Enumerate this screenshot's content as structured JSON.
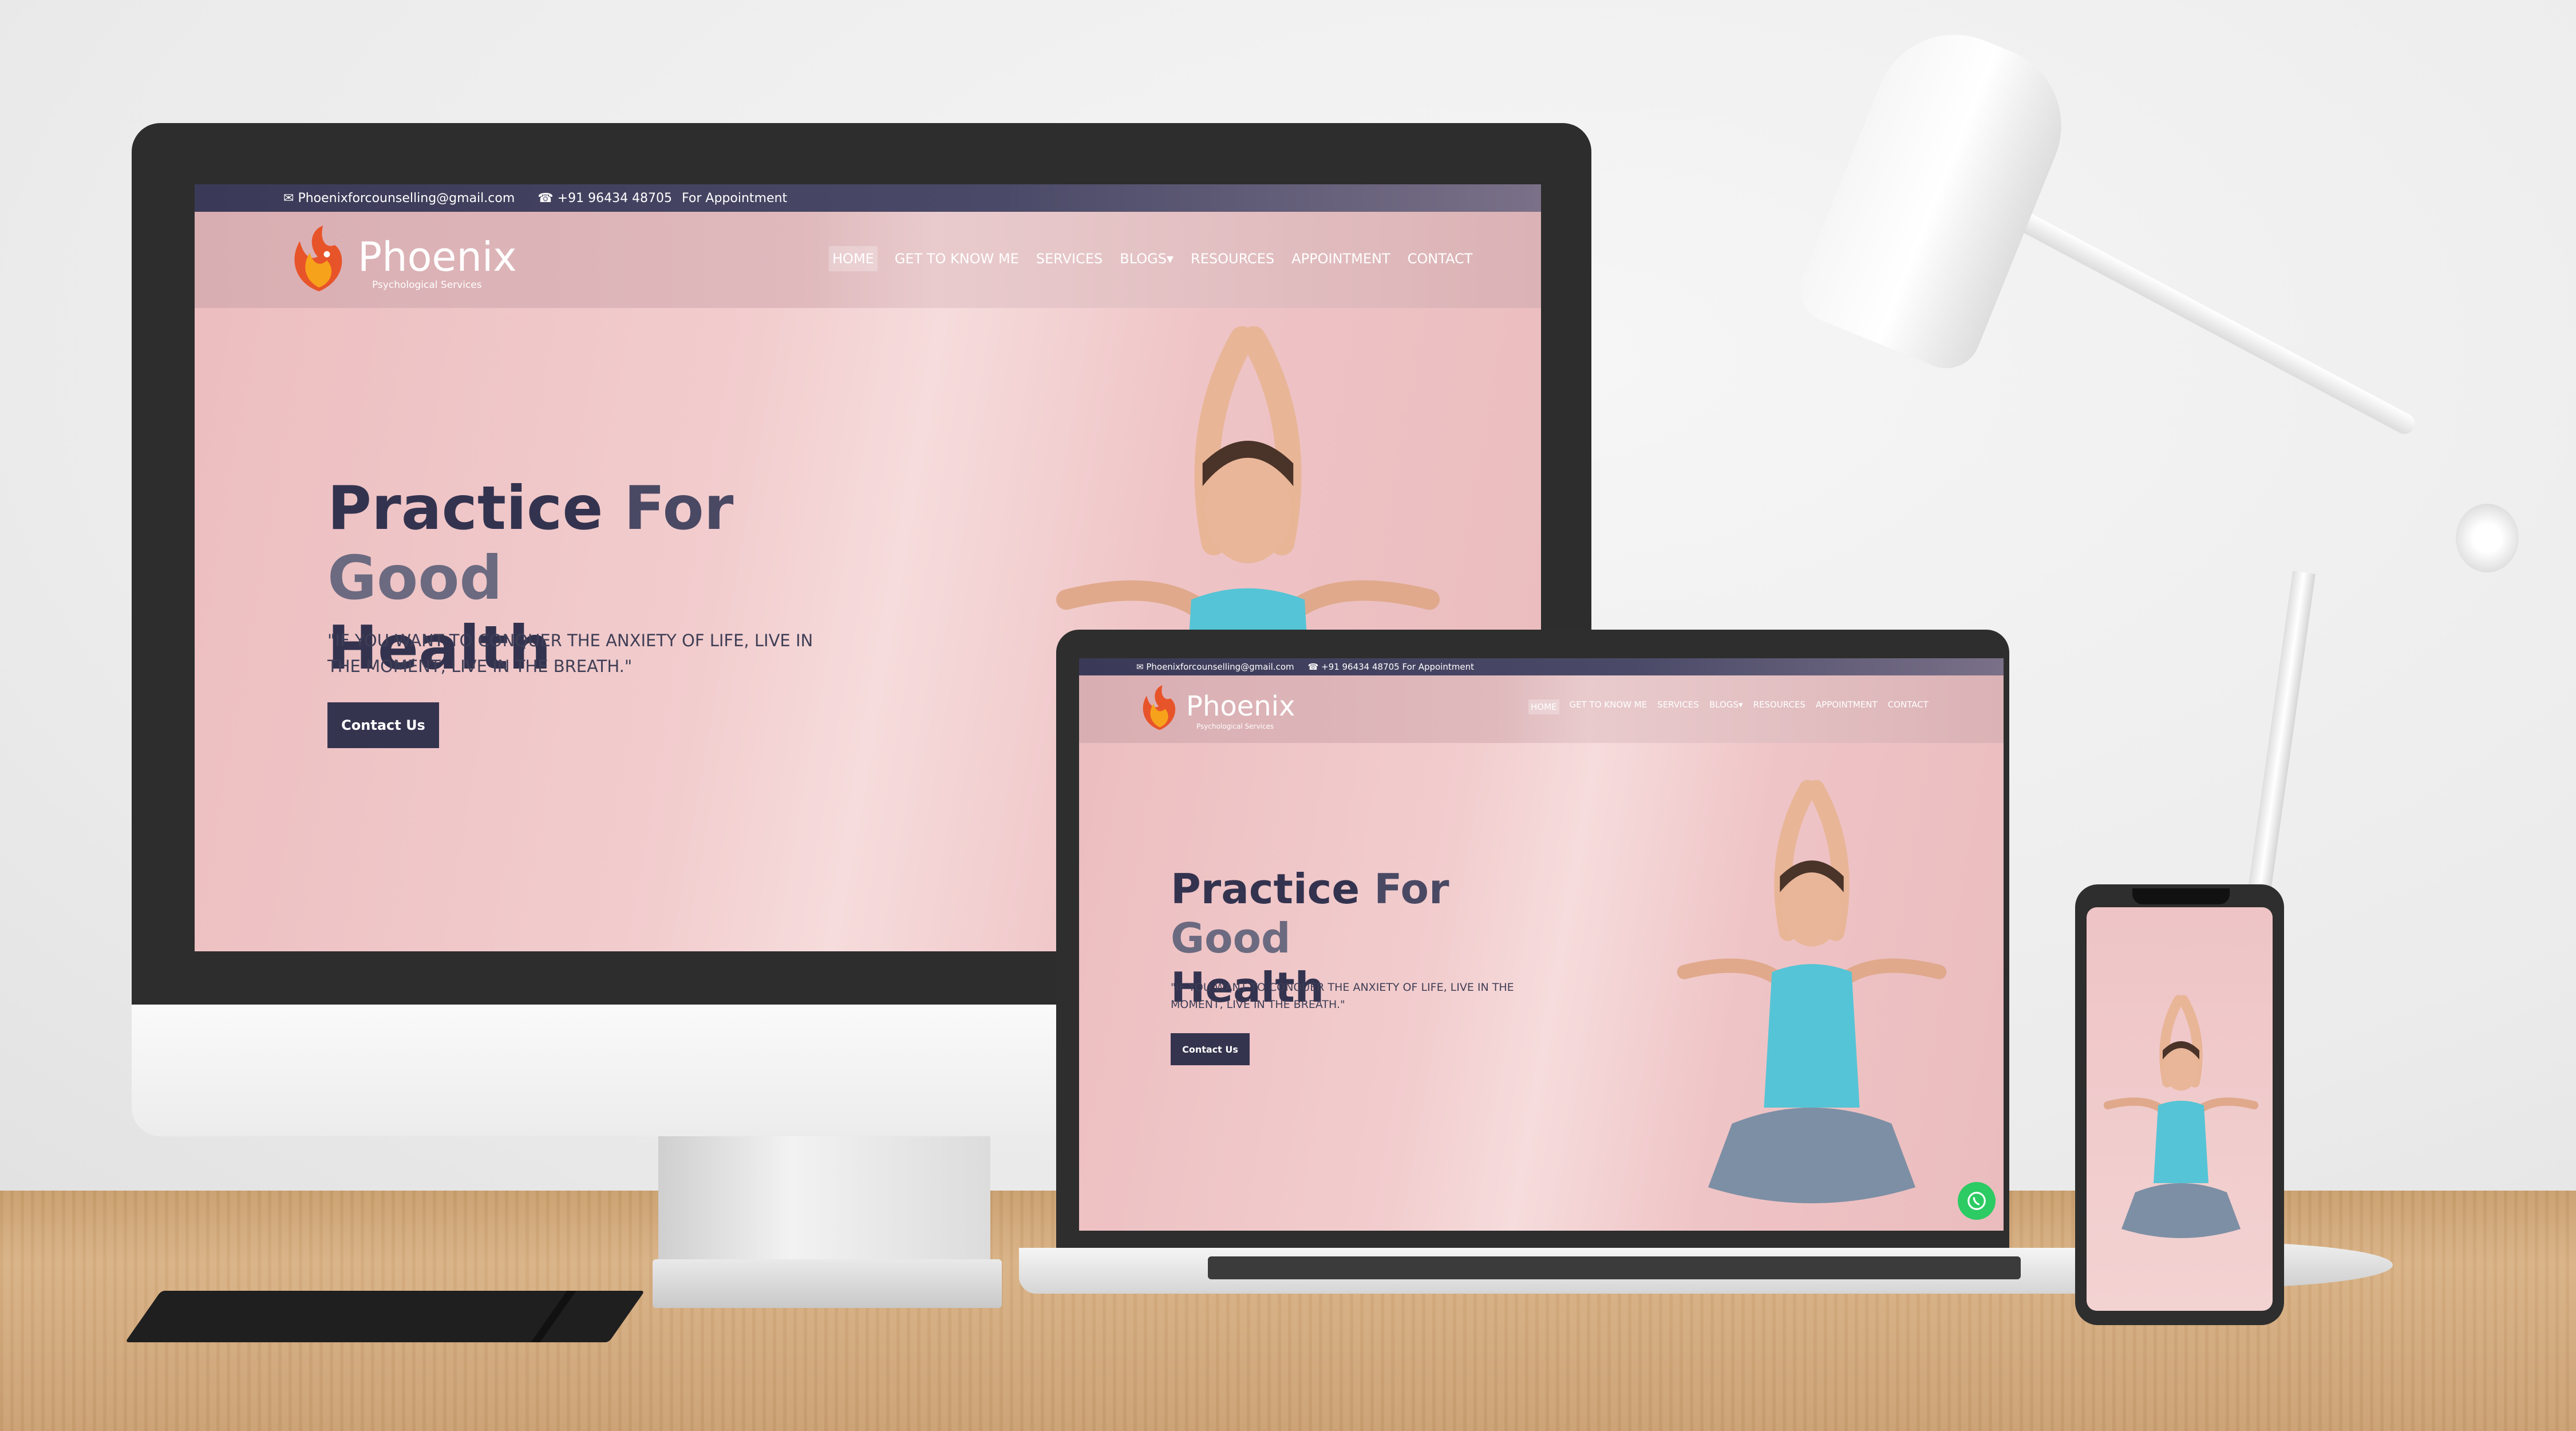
{
  "site": {
    "email": "Phoenixforcounselling@gmail.com",
    "phone": "+91 96434 48705",
    "appointment_label": "For Appointment",
    "brand": {
      "name": "Phoenix",
      "tagline": "Psychological Services"
    },
    "menu": [
      {
        "label": "HOME",
        "active": true
      },
      {
        "label": "GET TO KNOW ME"
      },
      {
        "label": "SERVICES"
      },
      {
        "label": "BLOGS"
      },
      {
        "label": "RESOURCES"
      },
      {
        "label": "APPOINTMENT"
      },
      {
        "label": "CONTACT"
      }
    ],
    "hero": {
      "title_w1": "Practice",
      "title_w2": "For",
      "title_w3": "Good",
      "title_w4": "Health",
      "quote": "\"IF YOU WANT TO CONQUER THE ANXIETY OF LIFE, LIVE IN THE MOMENT, LIVE IN THE BREATH.\"",
      "cta": "Contact Us"
    }
  },
  "colors": {
    "hero_bg": "#efc4c6",
    "topbar": "#3a3a58",
    "cta": "#35344f",
    "title": "#33334f",
    "whatsapp": "#2ccb63"
  },
  "icons": [
    "envelope-icon",
    "phone-icon",
    "phoenix-logo-icon",
    "chevron-down-icon",
    "whatsapp-icon"
  ]
}
